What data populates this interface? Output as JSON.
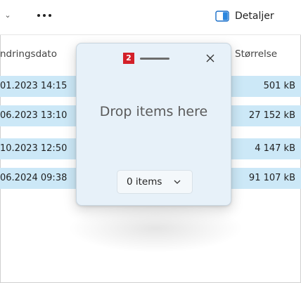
{
  "toolbar": {
    "details_label": "Detaljer"
  },
  "columns": {
    "modified": "ndringsdato",
    "size": "Størrelse"
  },
  "rows": [
    {
      "date": "01.2023 14:15",
      "size": "501 kB"
    },
    {
      "date": "06.2023 13:10",
      "size": "27 152 kB"
    },
    {
      "date": "10.2023 12:50",
      "size": "4 147 kB"
    },
    {
      "date": "06.2024 09:38",
      "size": "91 107 kB"
    }
  ],
  "drop_popup": {
    "badge": "2",
    "title": "Drop items here",
    "items_button": "0 items"
  },
  "colors": {
    "selection": "#cce8f7",
    "popup_bg": "#e7f1f9",
    "badge": "#d32029"
  }
}
